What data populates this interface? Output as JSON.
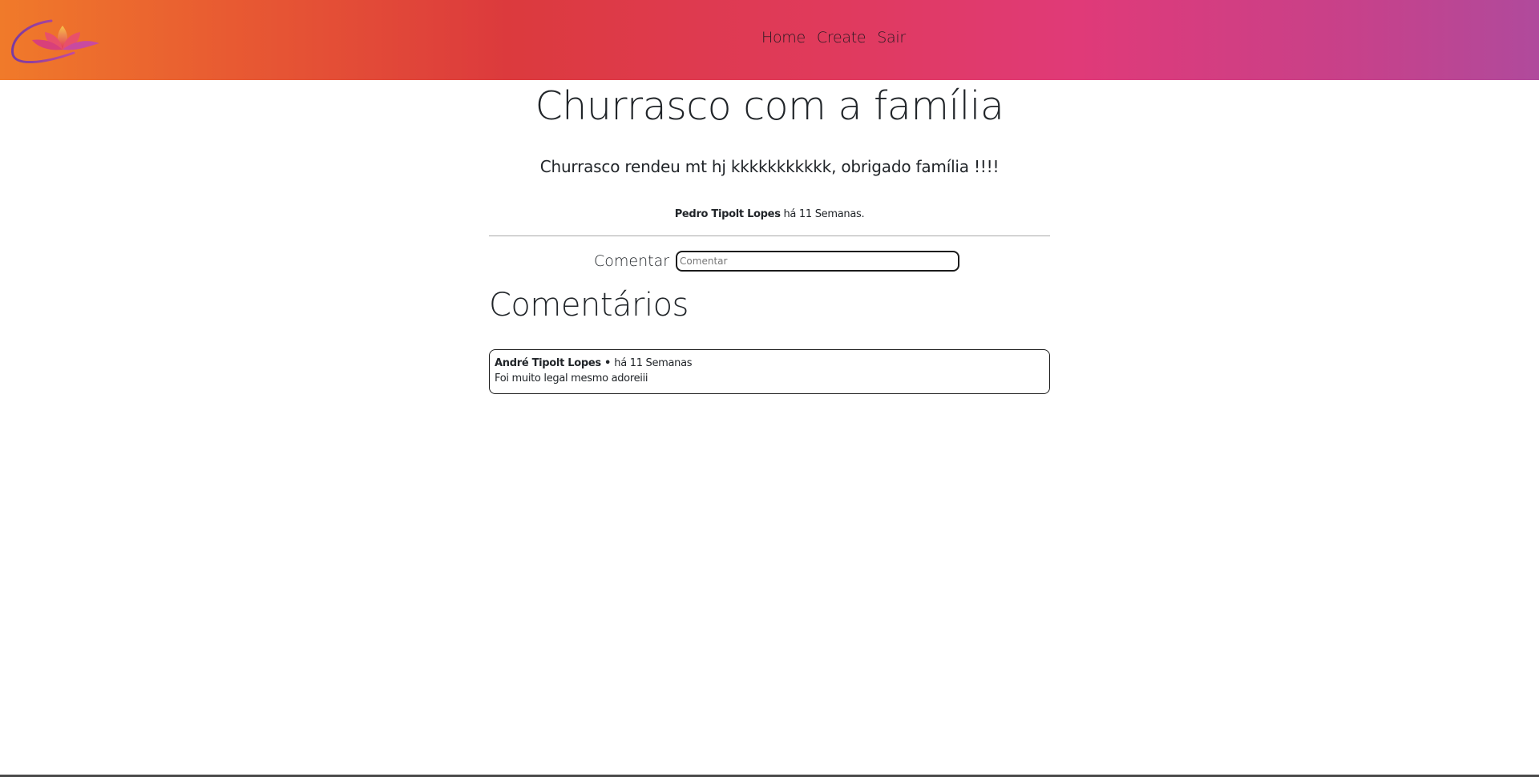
{
  "nav": {
    "logo": "lotus-logo",
    "links": [
      {
        "label": "Home"
      },
      {
        "label": "Create"
      },
      {
        "label": "Sair"
      }
    ],
    "gradient": [
      "#f07a2a",
      "#dc3a3d",
      "#e03a78",
      "#b04a9c"
    ]
  },
  "post": {
    "title": "Churrasco com a família",
    "body": "Churrasco rendeu mt hj kkkkkkkkkkk, obrigado família !!!!",
    "author": "Pedro Tipolt Lopes",
    "time": "há 11 Semanas."
  },
  "comment_form": {
    "label": "Comentar",
    "placeholder": "Comentar",
    "value": ""
  },
  "comments_section": {
    "heading": "Comentários",
    "items": [
      {
        "author": "André Tipolt Lopes",
        "separator": " • ",
        "time": "há 11 Semanas",
        "text": "Foi muito legal mesmo adoreiii"
      }
    ]
  }
}
